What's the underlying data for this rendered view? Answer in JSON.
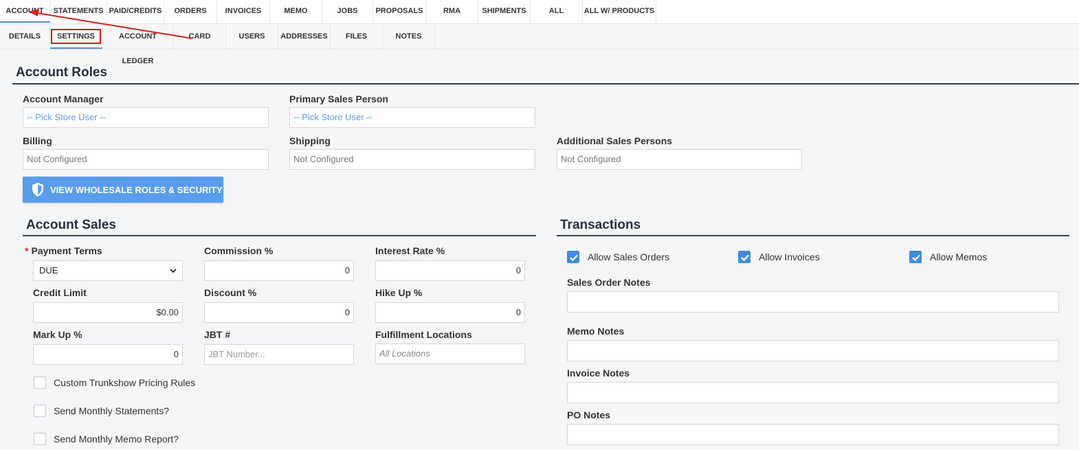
{
  "primary_tabs": [
    "ACCOUNT",
    "STATEMENTS",
    "PAID/CREDITS",
    "ORDERS",
    "INVOICES",
    "MEMO",
    "JOBS",
    "PROPOSALS",
    "RMA",
    "SHIPMENTS",
    "ALL",
    "ALL W/ PRODUCTS"
  ],
  "secondary_tabs": [
    "DETAILS",
    "SETTINGS",
    "ACCOUNT LEDGER",
    "CARD",
    "USERS",
    "ADDRESSES",
    "FILES",
    "NOTES"
  ],
  "account_roles": {
    "title": "Account Roles",
    "account_manager_label": "Account Manager",
    "account_manager_value": "-- Pick Store User --",
    "primary_sales_label": "Primary Sales Person",
    "primary_sales_value": "-- Pick Store User --",
    "billing_label": "Billing",
    "billing_value": "Not Configured",
    "shipping_label": "Shipping",
    "shipping_value": "Not Configured",
    "additional_sales_label": "Additional Sales Persons",
    "additional_sales_value": "Not Configured",
    "view_roles_button": "VIEW WHOLESALE ROLES & SECURITY"
  },
  "account_sales": {
    "title": "Account Sales",
    "payment_terms_required": "*",
    "payment_terms_label": "Payment Terms",
    "payment_terms_value": "DUE",
    "commission_label": "Commission %",
    "commission_value": "0",
    "interest_label": "Interest Rate %",
    "interest_value": "0",
    "credit_limit_label": "Credit Limit",
    "credit_limit_value": "$0.00",
    "discount_label": "Discount %",
    "discount_value": "0",
    "hike_label": "Hike Up %",
    "hike_value": "0",
    "markup_label": "Mark Up %",
    "markup_value": "0",
    "jbt_label": "JBT #",
    "jbt_placeholder": "JBT Number...",
    "fulfillment_label": "Fulfillment Locations",
    "fulfillment_placeholder": "All Locations",
    "custom_trunkshow": "Custom Trunkshow Pricing Rules",
    "monthly_statements": "Send Monthly Statements?",
    "monthly_memo": "Send Monthly Memo Report?"
  },
  "transactions": {
    "title": "Transactions",
    "allow_sales_orders": "Allow Sales Orders",
    "allow_invoices": "Allow Invoices",
    "allow_memos": "Allow Memos",
    "sales_order_notes": "Sales Order Notes",
    "memo_notes": "Memo Notes",
    "invoice_notes": "Invoice Notes",
    "po_notes": "PO Notes"
  },
  "colors": {
    "accent": "#4a90e2",
    "button": "#5a9ded",
    "checkbox": "#3c8de0",
    "highlight": "#d8151b"
  }
}
